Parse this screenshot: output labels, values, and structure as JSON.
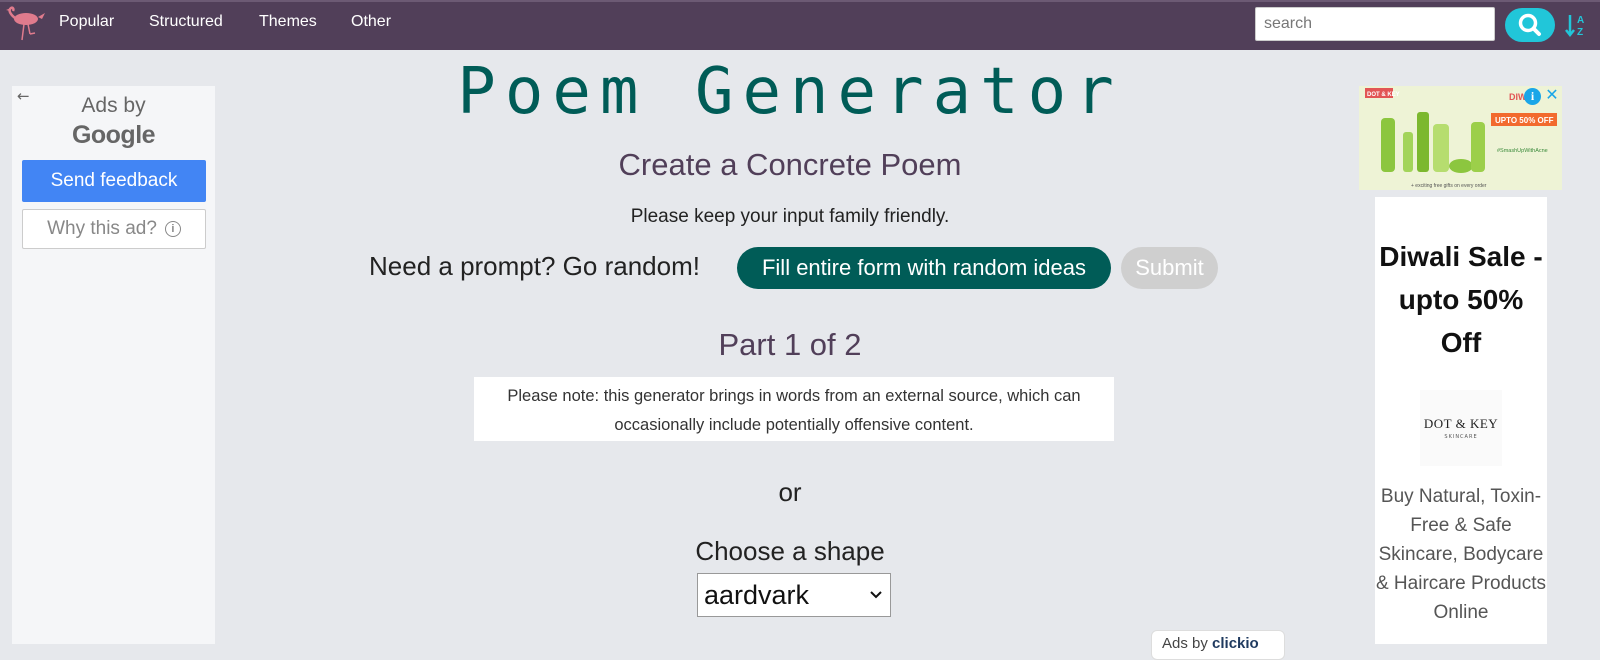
{
  "nav": {
    "links": [
      "Popular",
      "Structured",
      "Themes",
      "Other"
    ],
    "search_placeholder": "search",
    "brand_color": "#513f59"
  },
  "left_ad": {
    "ads_by": "Ads by",
    "google": "Google",
    "feedback": "Send feedback",
    "why": "Why this ad?",
    "back_icon": "arrow-left-icon"
  },
  "main": {
    "site_title": "Poem Generator",
    "subtitle": "Create a Concrete Poem",
    "family_note": "Please keep your input family friendly.",
    "prompt_text": "Need a prompt? Go random!",
    "random_button": "Fill entire form with random ideas",
    "submit_button": "Submit",
    "part_label": "Part 1 of 2",
    "warning": "Please note: this generator brings in words from an external source, which can occasionally include potentially offensive content.",
    "or_text": "or",
    "choose_label": "Choose a shape",
    "shape_selected": "aardvark",
    "accent_color": "#005c57"
  },
  "right_ad": {
    "banner_brand": "DOT & KEY",
    "banner_sale": "DIWALI",
    "banner_offer": "UPTO 50% OFF",
    "banner_tag": "#SmashUpWithAcne",
    "banner_footer": "+ exciting free gifts on every order",
    "deal_title": "Diwali Sale - upto 50% Off",
    "brand_name": "DOT & KEY",
    "brand_sub": "SKINCARE",
    "deal_text": "Buy Natural, Toxin-Free & Safe Skincare, Bodycare & Haircare Products Online"
  },
  "bottom_badge": {
    "prefix": "Ads by",
    "brand": "clickio"
  }
}
